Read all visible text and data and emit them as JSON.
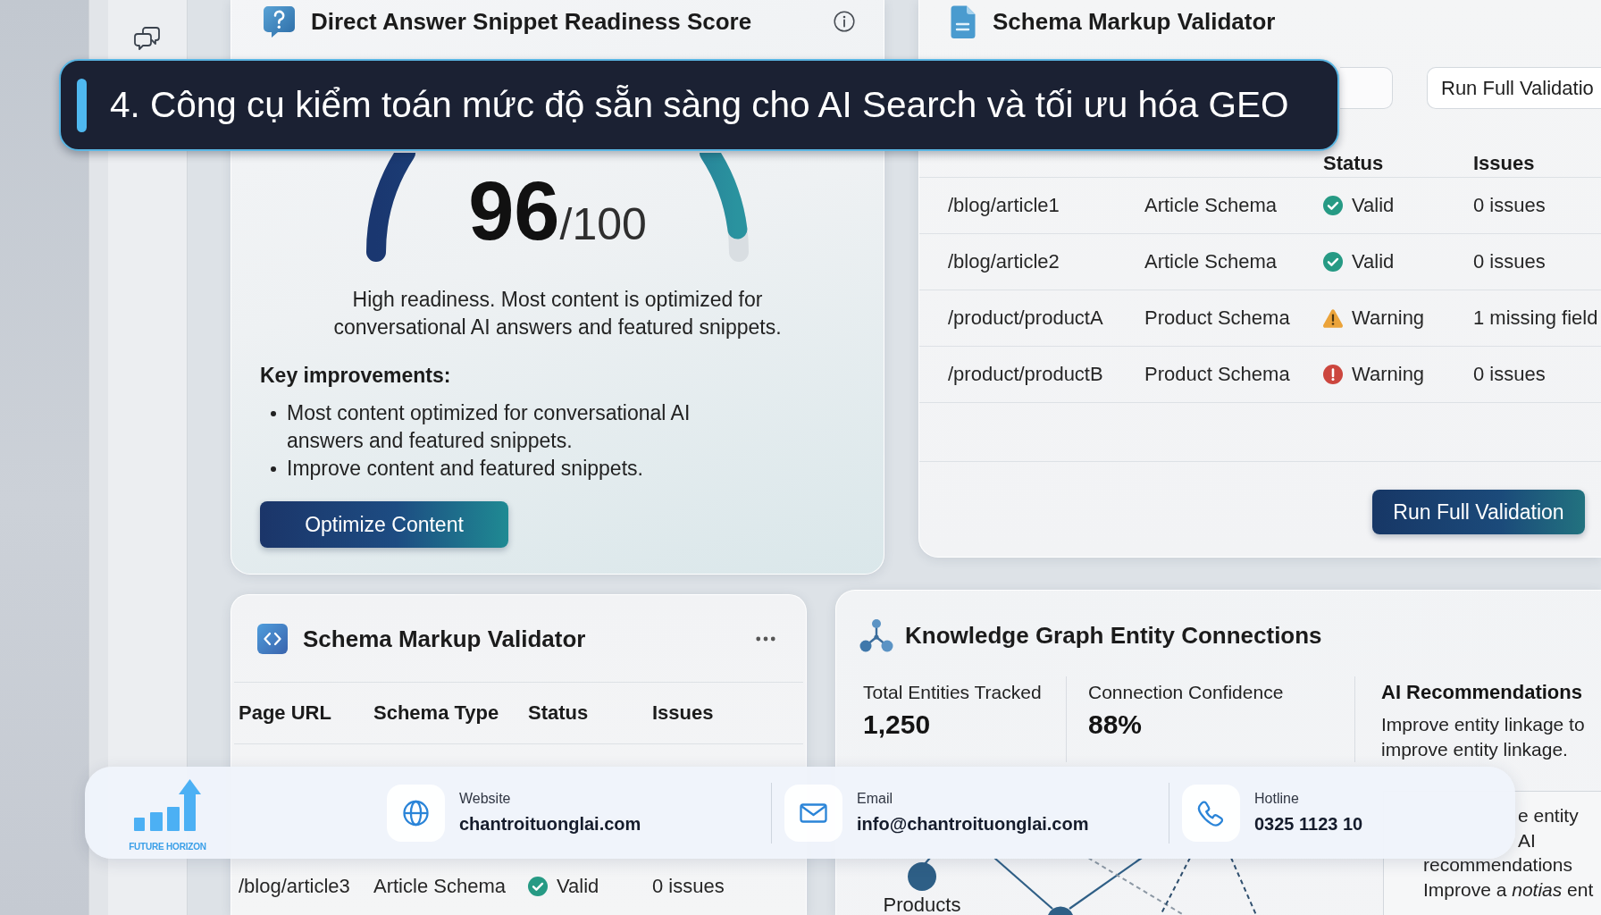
{
  "banner": {
    "title": "4. Công cụ kiểm toán mức độ sẵn sàng cho AI Search và tối ưu hóa GEO"
  },
  "readiness": {
    "title": "Direct Answer Snippet Readiness Score",
    "level": 0.96,
    "score": "96",
    "score_max": "/100",
    "summary": "High readiness. Most content is optimized for conversational AI answers and featured snippets.",
    "improvements_title": "Key improvements:",
    "improvements": [
      "Most content optimized for conversational AI answers and featured snippets.",
      "Improve content and featured snippets."
    ],
    "button": "Optimize Content"
  },
  "validator": {
    "title": "Schema Markup Validator",
    "toolbar_button": "Run Full Validatio",
    "header": {
      "status": "Status",
      "issues": "Issues"
    },
    "rows": [
      {
        "page_url": "/blog/article1",
        "schema_type": "Article Schema",
        "kind": "valid",
        "status": "Valid",
        "issues": "0 issues"
      },
      {
        "page_url": "/blog/article2",
        "schema_type": "Article Schema",
        "kind": "valid",
        "status": "Valid",
        "issues": "0 issues"
      },
      {
        "page_url": "/product/productA",
        "schema_type": "Product Schema",
        "kind": "warning",
        "status": "Warning",
        "issues": "1 missing field"
      },
      {
        "page_url": "/product/productB",
        "schema_type": "Product Schema",
        "kind": "error",
        "status": "Warning",
        "issues": "0 issues"
      }
    ],
    "button": "Run Full Validation"
  },
  "schema_card": {
    "title": "Schema Markup Validator",
    "columns": [
      "Page URL",
      "Schema Type",
      "Status",
      "Issues"
    ],
    "rows": [
      {
        "page_url": "/blog/article3",
        "schema_type": "Article Schema",
        "kind": "valid",
        "status": "Valid",
        "issues": "0 issues"
      }
    ]
  },
  "knowledge_graph": {
    "title": "Knowledge Graph Entity Connections",
    "stats": [
      {
        "label": "Total Entities Tracked",
        "value": "1,250"
      },
      {
        "label": "Connection Confidence",
        "value": "88%"
      }
    ],
    "recommendations": {
      "title": "AI Recommendations",
      "text": "Improve entity linkage to improve entity linkage."
    },
    "node_label": "Products",
    "panel_lines": [
      {
        "kind": "clipped",
        "text": "e entity"
      },
      {
        "kind": "clipped",
        "text": "AI"
      },
      {
        "kind": "full",
        "text": "recommendations"
      },
      {
        "kind": "full",
        "text": "Improve a *notias* ent"
      }
    ]
  },
  "footer": {
    "brand": "FUTURE HORIZON",
    "contacts": [
      {
        "kind": "website",
        "label": "Website",
        "value": "chantroituonglai.com"
      },
      {
        "kind": "email",
        "label": "Email",
        "value": "info@chantroituonglai.com"
      },
      {
        "kind": "phone",
        "label": "Hotline",
        "value": "0325 1123 10"
      }
    ]
  }
}
